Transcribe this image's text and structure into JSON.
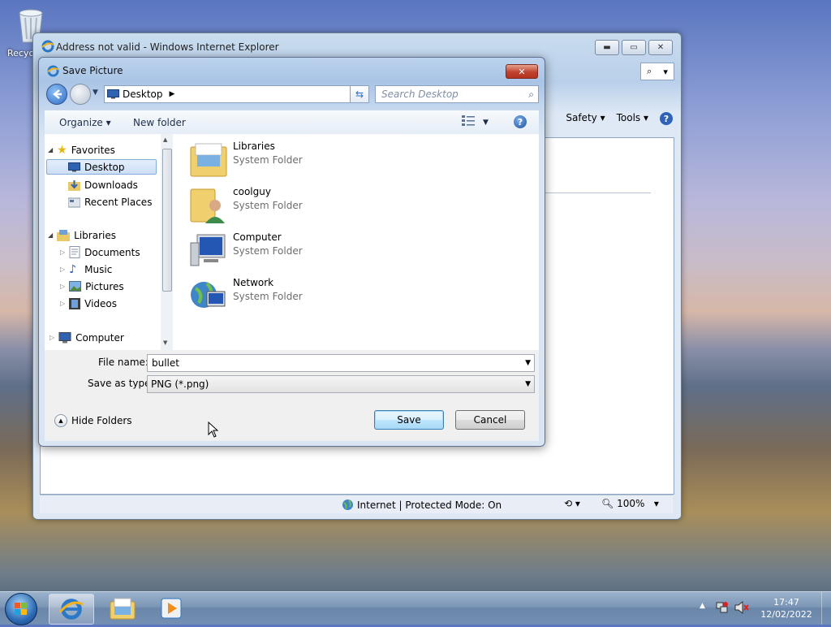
{
  "desktop": {
    "recycle_label": "Recyc"
  },
  "ie": {
    "title": "Address not valid - Windows Internet Explorer",
    "commands": [
      "Safety",
      "Tools"
    ],
    "status_zone": "Internet | Protected Mode: On",
    "zoom": "100%"
  },
  "dialog": {
    "title": "Save Picture",
    "address": "Desktop",
    "search_placeholder": "Search Desktop",
    "toolbar": {
      "organize": "Organize",
      "new_folder": "New folder"
    },
    "nav": {
      "favorites": "Favorites",
      "desktop": "Desktop",
      "downloads": "Downloads",
      "recent": "Recent Places",
      "libraries": "Libraries",
      "documents": "Documents",
      "music": "Music",
      "pictures": "Pictures",
      "videos": "Videos",
      "computer": "Computer"
    },
    "files": [
      {
        "name": "Libraries",
        "type": "System Folder"
      },
      {
        "name": "coolguy",
        "type": "System Folder"
      },
      {
        "name": "Computer",
        "type": "System Folder"
      },
      {
        "name": "Network",
        "type": "System Folder"
      }
    ],
    "file_name_label": "File name:",
    "file_name_value": "bullet",
    "save_type_label": "Save as type:",
    "save_type_value": "PNG (*.png)",
    "hide_folders": "Hide Folders",
    "save": "Save",
    "cancel": "Cancel"
  },
  "taskbar": {
    "time": "17:47",
    "date": "12/02/2022"
  }
}
